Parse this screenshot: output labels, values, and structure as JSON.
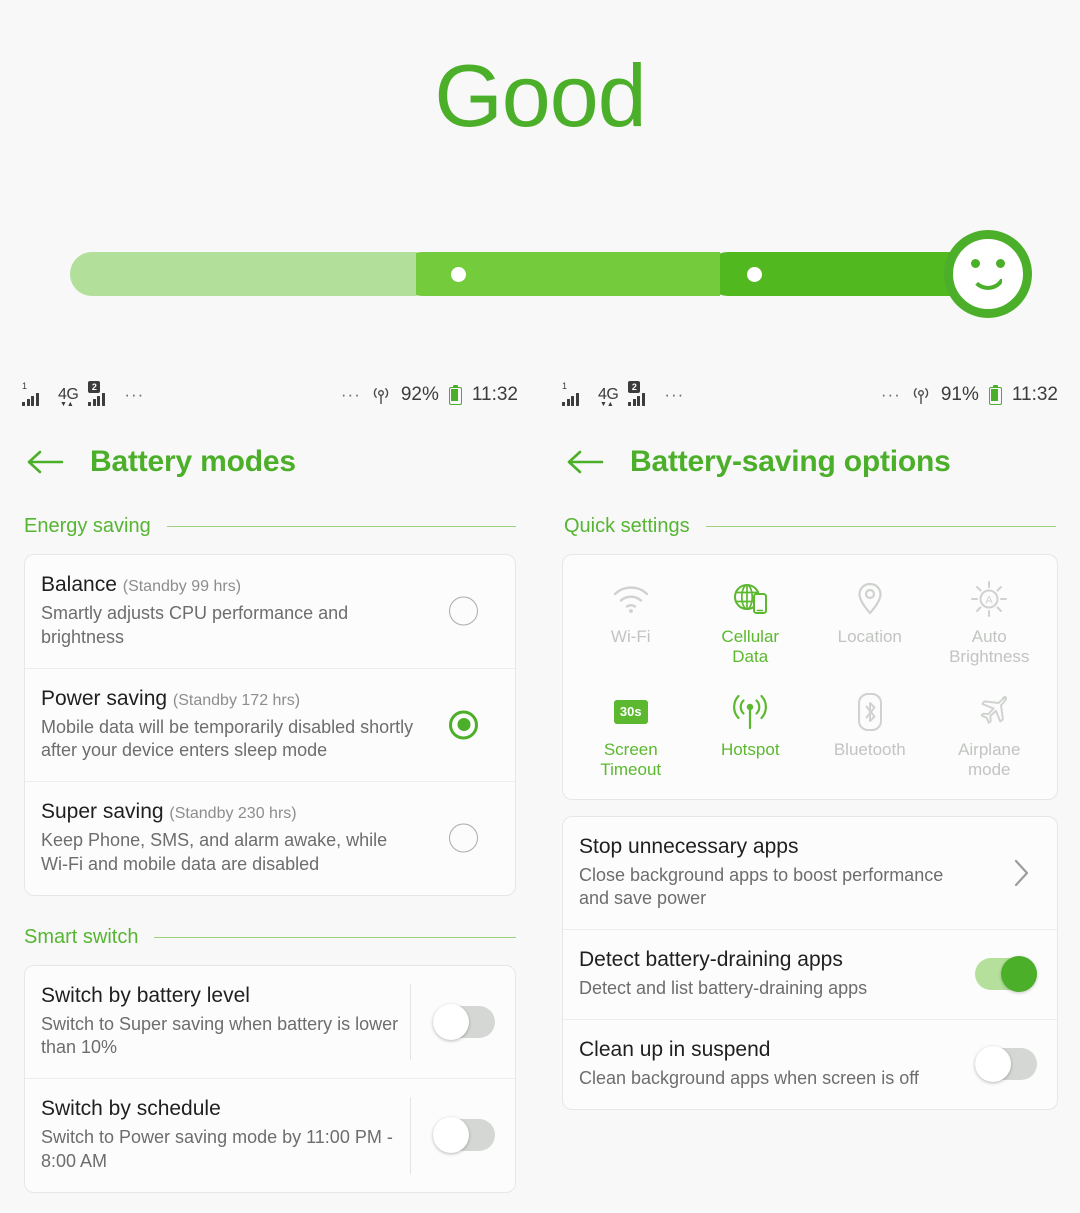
{
  "hero": {
    "title": "Good",
    "gauge": {
      "segments": [
        "low",
        "medium",
        "high"
      ],
      "face_icon": "smiley-face-icon",
      "colors": {
        "low": "#b2df99",
        "medium": "#74cc3d",
        "high": "#52b820",
        "accent": "#4caf2a"
      }
    }
  },
  "left": {
    "status_bar": {
      "sim1_icon": "signal-bars-sim1-icon",
      "sim1_label": "1",
      "network": "4G",
      "sim2_icon": "signal-bars-sim2-icon",
      "sim2_badge": "2",
      "overflow": "···",
      "right_overflow": "···",
      "location_icon": "location-broadcast-icon",
      "battery_percent": "92%",
      "battery_icon": "battery-icon",
      "time": "11:32"
    },
    "header": {
      "back_icon": "back-arrow-icon",
      "title": "Battery modes"
    },
    "sections": [
      {
        "label": "Energy saving",
        "rows": [
          {
            "title": "Balance",
            "subtitle": "(Standby 99 hrs)",
            "desc": "Smartly adjusts CPU performance and brightness",
            "control": "radio",
            "selected": false
          },
          {
            "title": "Power saving",
            "subtitle": "(Standby 172 hrs)",
            "desc": "Mobile data will be temporarily disabled shortly after your device enters sleep mode",
            "control": "radio",
            "selected": true
          },
          {
            "title": "Super saving",
            "subtitle": "(Standby 230 hrs)",
            "desc": "Keep Phone, SMS, and alarm awake, while Wi-Fi and mobile data are disabled",
            "control": "radio",
            "selected": false
          }
        ]
      },
      {
        "label": "Smart switch",
        "rows": [
          {
            "title": "Switch by battery level",
            "subtitle": "",
            "desc": "Switch to Super saving when battery is lower than 10%",
            "control": "toggle",
            "selected": false
          },
          {
            "title": "Switch by schedule",
            "subtitle": "",
            "desc": "Switch to Power saving mode by 11:00 PM - 8:00 AM",
            "control": "toggle",
            "selected": false
          }
        ]
      }
    ]
  },
  "right": {
    "status_bar": {
      "sim1_label": "1",
      "network": "4G",
      "sim2_badge": "2",
      "overflow": "···",
      "right_overflow": "···",
      "location_icon": "location-broadcast-icon",
      "battery_percent": "91%",
      "battery_icon": "battery-icon",
      "time": "11:32"
    },
    "header": {
      "back_icon": "back-arrow-icon",
      "title": "Battery-saving options"
    },
    "quick_settings": {
      "label": "Quick settings",
      "tiles": [
        {
          "label": "Wi-Fi",
          "icon": "wifi-icon",
          "active": false
        },
        {
          "label": "Cellular\nData",
          "icon": "cellular-data-icon",
          "active": true
        },
        {
          "label": "Location",
          "icon": "location-pin-icon",
          "active": false
        },
        {
          "label": "Auto\nBrightness",
          "icon": "auto-brightness-icon",
          "active": false
        },
        {
          "label": "Screen\nTimeout",
          "icon": "screen-timeout-icon",
          "active": true,
          "badge": "30s"
        },
        {
          "label": "Hotspot",
          "icon": "hotspot-icon",
          "active": true
        },
        {
          "label": "Bluetooth",
          "icon": "bluetooth-icon",
          "active": false
        },
        {
          "label": "Airplane\nmode",
          "icon": "airplane-icon",
          "active": false
        }
      ]
    },
    "options": [
      {
        "title": "Stop unnecessary apps",
        "desc": "Close background apps to boost performance and save power",
        "control": "chevron",
        "selected": false
      },
      {
        "title": "Detect battery-draining apps",
        "desc": "Detect and list battery-draining apps",
        "control": "toggle",
        "selected": true
      },
      {
        "title": "Clean up in suspend",
        "desc": "Clean background apps when screen is off",
        "control": "toggle",
        "selected": false
      }
    ]
  }
}
